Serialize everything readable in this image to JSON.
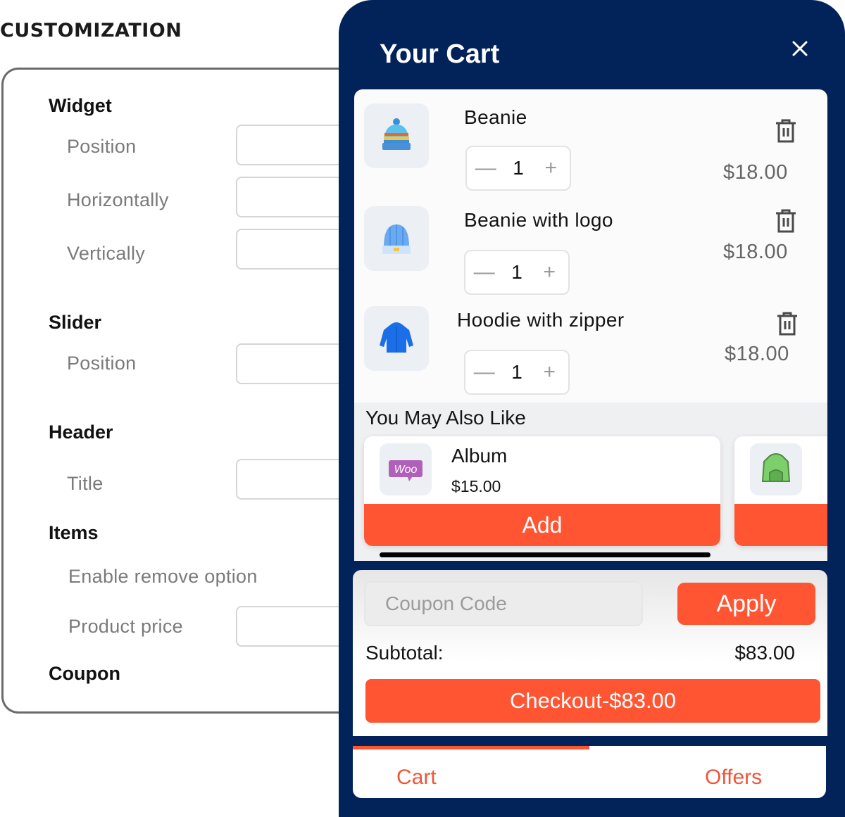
{
  "customization": {
    "title": "CUSTOMIZATION",
    "sections": {
      "widget": "Widget",
      "slider": "Slider",
      "header": "Header",
      "items": "Items",
      "coupon": "Coupon"
    },
    "fields": {
      "widget_position": "Position",
      "widget_horizontally": "Horizontally",
      "widget_vertically": "Vertically",
      "slider_position": "Position",
      "header_title": "Title",
      "items_enable_remove": "Enable remove option",
      "items_product_price": "Product price"
    }
  },
  "cart": {
    "title": "Your Cart",
    "close_icon": "close-icon",
    "items": [
      {
        "name": "Beanie",
        "quantity": "1",
        "price": "$18.00",
        "icon": "beanie-icon"
      },
      {
        "name": "Beanie with logo",
        "quantity": "1",
        "price": "$18.00",
        "icon": "beanie-logo-icon"
      },
      {
        "name": "Hoodie with zipper",
        "quantity": "1",
        "price": "$18.00",
        "icon": "hoodie-icon"
      }
    ],
    "qty_minus": "—",
    "qty_plus": "+",
    "upsell": {
      "title": "You May Also Like",
      "products": [
        {
          "name": "Album",
          "price": "$15.00",
          "add_label": "Add",
          "icon": "woo-logo-icon"
        },
        {
          "name": "",
          "price": "",
          "add_label": "",
          "icon": "green-hoodie-icon"
        }
      ]
    },
    "coupon": {
      "placeholder": "Coupon Code",
      "value": "",
      "apply_label": "Apply"
    },
    "subtotal": {
      "label": "Subtotal:",
      "value": "$83.00"
    },
    "checkout_label": "Checkout-$83.00",
    "tabs": [
      {
        "label": "Cart",
        "active": true
      },
      {
        "label": "Offers",
        "active": false
      }
    ],
    "colors": {
      "navy": "#02225a",
      "accent": "#ff5533"
    }
  }
}
